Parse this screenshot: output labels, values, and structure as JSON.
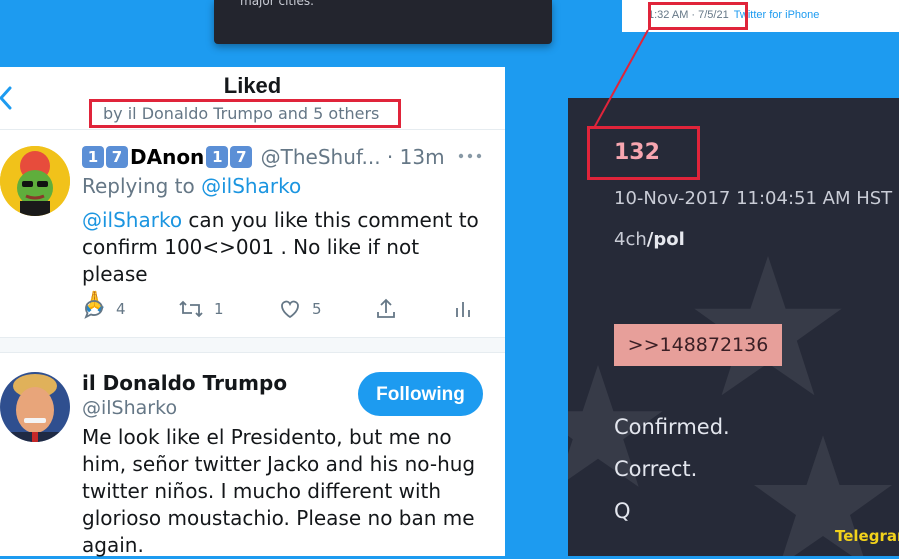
{
  "top_left_snippet": {
    "text": "major cities."
  },
  "top_right_snippet": {
    "time": "1:32 AM · 7/5/21",
    "source": "Twitter for iPhone"
  },
  "twitter": {
    "header_title": "Liked",
    "liked_by": "by il Donaldo Trumpo and 5 others",
    "tweet1": {
      "display_name": "DAnon",
      "keycap_a": "1",
      "keycap_b": "7",
      "handle_time": "@TheShuf... · 13m",
      "replying_prefix": "Replying to ",
      "replying_handle": "@ilSharko",
      "body_mention": "@ilSharko",
      "body_text": " can you like this comment  to confirm 100<>001 . No like if not please",
      "emoji": "🙏",
      "reply_count": "4",
      "retweet_count": "1",
      "like_count": "5"
    },
    "tweet2": {
      "display_name": "il Donaldo Trumpo",
      "handle": "@ilSharko",
      "follow_label": "Following",
      "body_text": "Me look like el Presidento, but me no him, señor twitter Jacko and his no-hug twitter niños. I mucho different with glorioso moustachio. Please no ban me again."
    }
  },
  "qpost": {
    "number": "132",
    "date": "10-Nov-2017 11:04:51 AM HST",
    "board_prefix": "4ch",
    "board_name": "/pol",
    "reply_link": ">>148872136",
    "line1": "Confirmed.",
    "line2": "Correct.",
    "line3": "Q"
  },
  "watermark": "Telegram",
  "colors": {
    "background": "#1d9bf0",
    "highlight_box": "#e0243a",
    "twitter_blue": "#1b95e0",
    "dark_panel": "#262a38",
    "post_number": "#f7a6b0",
    "reply_link_bg": "#e79f9a",
    "watermark": "#f2d21b"
  }
}
